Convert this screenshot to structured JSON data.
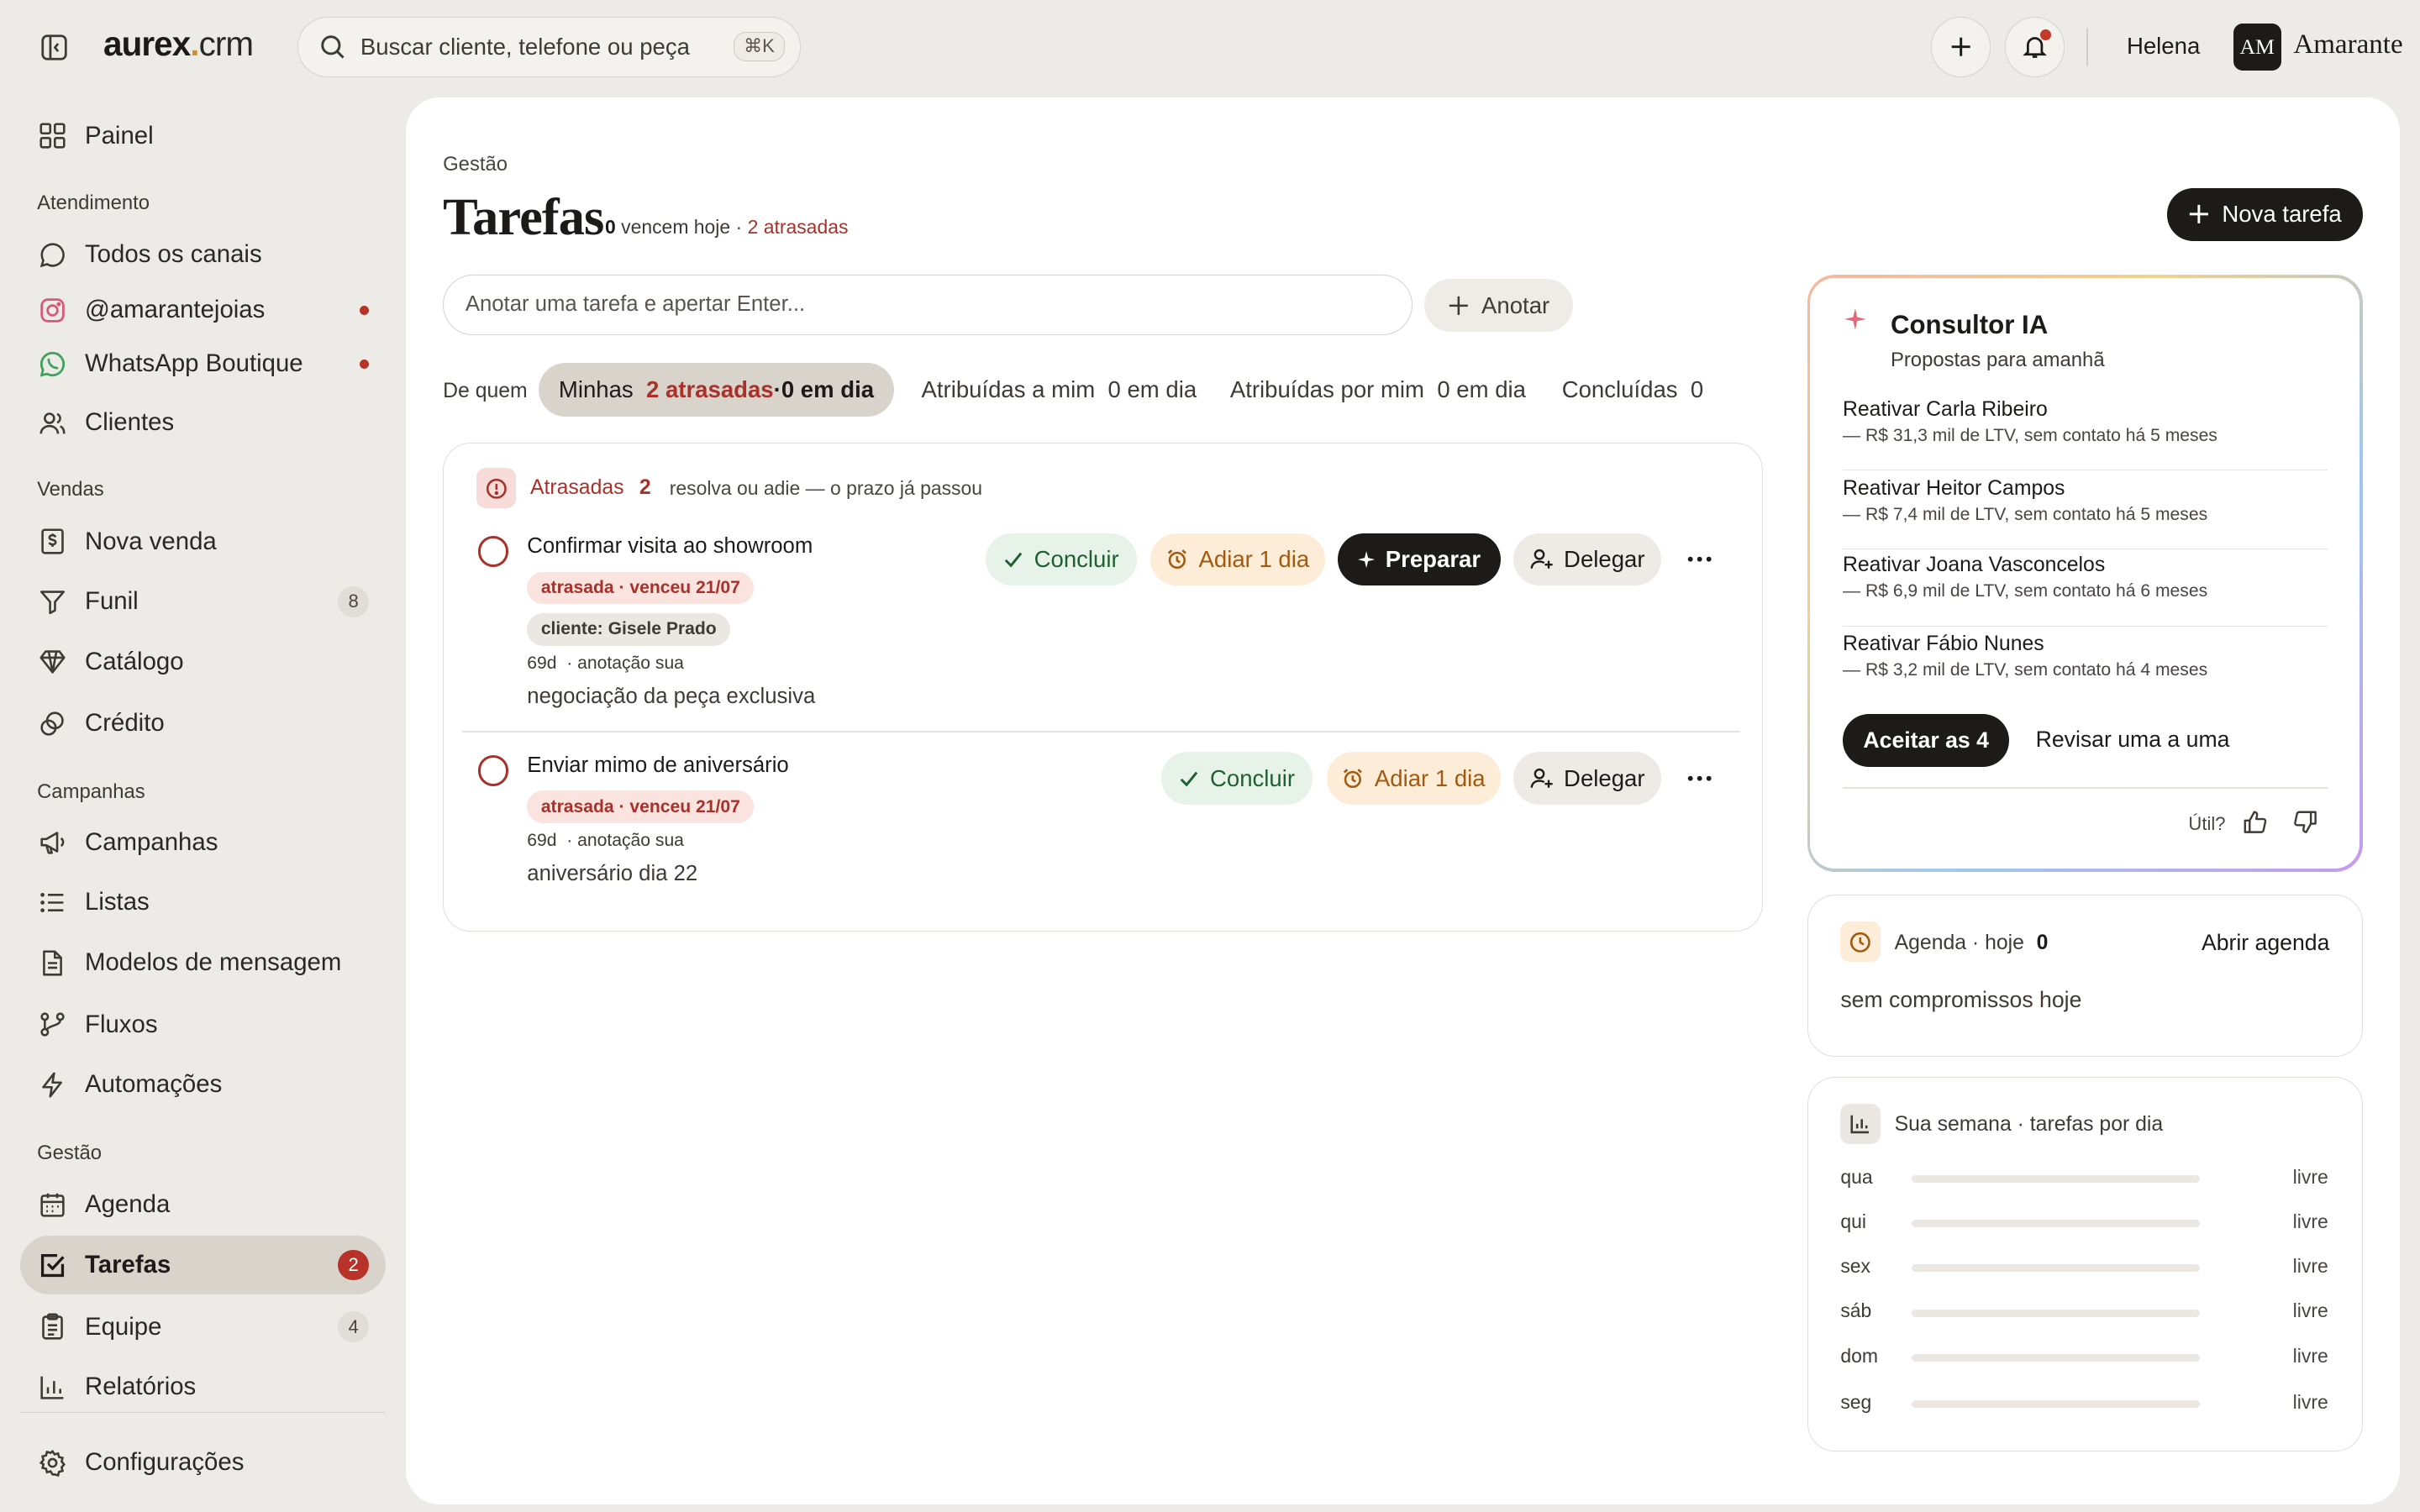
{
  "app": {
    "logo_bold": "aurex",
    "logo_dot": ".",
    "logo_light": "crm",
    "search_placeholder": "Buscar cliente, telefone ou peça",
    "search_shortcut": "⌘K",
    "user_name": "Helena",
    "avatar_initials": "AM",
    "brand_name": "Amarante"
  },
  "sidebar": {
    "items": [
      {
        "label": "Painel",
        "icon": "grid-icon"
      },
      {
        "label": "Todos os canais",
        "icon": "chat-bubble-icon"
      },
      {
        "label": "@amarantejoias",
        "icon": "instagram-icon",
        "unread": true
      },
      {
        "label": "WhatsApp Boutique",
        "icon": "whatsapp-icon",
        "unread": true
      },
      {
        "label": "Clientes",
        "icon": "users-icon"
      },
      {
        "label": "Nova venda",
        "icon": "dollar-receipt-icon"
      },
      {
        "label": "Funil",
        "icon": "filter-icon",
        "count": "8"
      },
      {
        "label": "Catálogo",
        "icon": "gem-icon"
      },
      {
        "label": "Crédito",
        "icon": "coins-icon"
      },
      {
        "label": "Campanhas",
        "icon": "megaphone-icon"
      },
      {
        "label": "Listas",
        "icon": "list-icon"
      },
      {
        "label": "Modelos de mensagem",
        "icon": "document-icon"
      },
      {
        "label": "Fluxos",
        "icon": "branch-icon"
      },
      {
        "label": "Automações",
        "icon": "bolt-icon"
      },
      {
        "label": "Agenda",
        "icon": "calendar-icon"
      },
      {
        "label": "Tarefas",
        "icon": "checkbox-icon",
        "count": "2",
        "active": true
      },
      {
        "label": "Equipe",
        "icon": "clipboard-icon",
        "count": "4"
      },
      {
        "label": "Relatórios",
        "icon": "bar-chart-icon"
      },
      {
        "label": "Configurações",
        "icon": "gear-icon"
      }
    ],
    "sections": [
      "Atendimento",
      "Vendas",
      "Campanhas",
      "Gestão"
    ]
  },
  "header": {
    "breadcrumb": "Gestão",
    "title": "Tarefas",
    "due_today_count": "0",
    "due_today_label": "vencem hoje ·",
    "overdue_label": "2 atrasadas",
    "new_task_label": "Nova tarefa"
  },
  "quick_add": {
    "placeholder": "Anotar uma tarefa e apertar Enter...",
    "button_label": "Anotar"
  },
  "filters": {
    "label": "De quem",
    "tabs": [
      {
        "label": "Minhas",
        "overdue": "2 atrasadas",
        "sep": " · ",
        "ontime": "0 em dia",
        "active": true
      },
      {
        "label": "Atribuídas a mim",
        "count": "0 em dia"
      },
      {
        "label": "Atribuídas por mim",
        "count": "0 em dia"
      },
      {
        "label": "Concluídas",
        "count": "0"
      }
    ]
  },
  "overdue_section": {
    "title": "Atrasadas",
    "count": "2",
    "subtitle": "resolva ou adie — o prazo já passou",
    "tasks": [
      {
        "name": "Confirmar visita ao showroom",
        "status_tag": "atrasada · venceu 21/07",
        "client_tag": "cliente: Gisele Prado",
        "age": "69d",
        "source": "· anotação sua",
        "note": "negociação da peça exclusiva",
        "actions": {
          "complete": "Concluir",
          "postpone": "Adiar 1 dia",
          "prepare": "Preparar",
          "delegate": "Delegar"
        }
      },
      {
        "name": "Enviar mimo de aniversário",
        "status_tag": "atrasada · venceu 21/07",
        "age": "69d",
        "source": "· anotação sua",
        "note": "aniversário dia 22",
        "actions": {
          "complete": "Concluir",
          "postpone": "Adiar 1 dia",
          "delegate": "Delegar"
        }
      }
    ]
  },
  "ai_advisor": {
    "title": "Consultor IA",
    "subtitle": "Propostas para amanhã",
    "proposals": [
      {
        "name": "Reativar Carla Ribeiro",
        "detail": "— R$ 31,3 mil de LTV, sem contato há 5 meses"
      },
      {
        "name": "Reativar Heitor Campos",
        "detail": "— R$ 7,4 mil de LTV, sem contato há 5 meses"
      },
      {
        "name": "Reativar Joana Vasconcelos",
        "detail": "— R$ 6,9 mil de LTV, sem contato há 6 meses"
      },
      {
        "name": "Reativar Fábio Nunes",
        "detail": "— R$ 3,2 mil de LTV, sem contato há 4 meses"
      }
    ],
    "accept_label": "Aceitar as 4",
    "review_label": "Revisar uma a uma",
    "useful_label": "Útil?"
  },
  "agenda": {
    "title": "Agenda · hoje",
    "count": "0",
    "open_label": "Abrir agenda",
    "empty_text": "sem compromissos hoje"
  },
  "week": {
    "title": "Sua semana · tarefas por dia",
    "days": [
      {
        "day": "qua",
        "status": "livre",
        "load": 0
      },
      {
        "day": "qui",
        "status": "livre",
        "load": 0
      },
      {
        "day": "sex",
        "status": "livre",
        "load": 0
      },
      {
        "day": "sáb",
        "status": "livre",
        "load": 0
      },
      {
        "day": "dom",
        "status": "livre",
        "load": 0
      },
      {
        "day": "seg",
        "status": "livre",
        "load": 0
      }
    ]
  },
  "colors": {
    "accent": "#1d1b19",
    "danger": "#a8312a",
    "success_bg": "#e7f3e8",
    "warning_bg": "#fcecd8",
    "background": "#edebe7"
  }
}
